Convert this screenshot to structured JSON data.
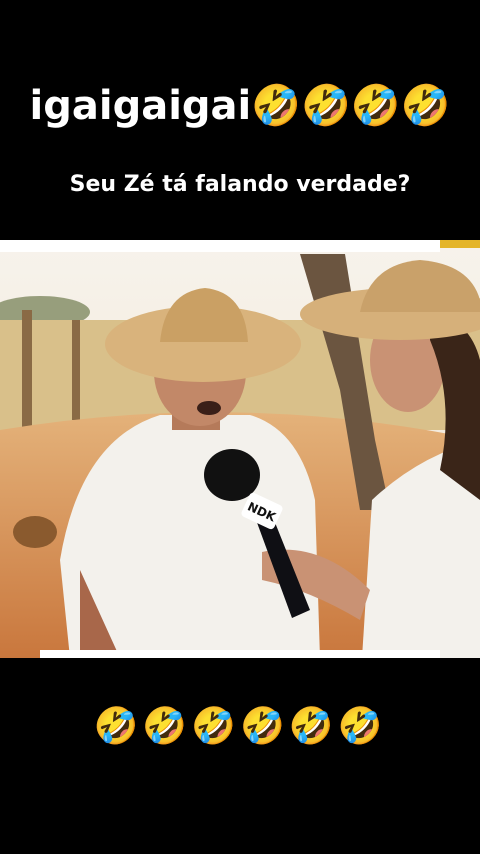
{
  "caption": {
    "title_text": "igaigaigai",
    "title_emojis": "🤣🤣🤣🤣",
    "subtitle": "Seu Zé tá falando verdade?"
  },
  "video": {
    "mic_logo": "NDK",
    "colors": {
      "sky": "#f4ede2",
      "ground": "#d79253",
      "shirt": "#f3f1ec",
      "hat": "#d9b37c",
      "mic": "#111111"
    }
  },
  "footer": {
    "emojis": "🤣🤣🤣🤣🤣🤣"
  }
}
